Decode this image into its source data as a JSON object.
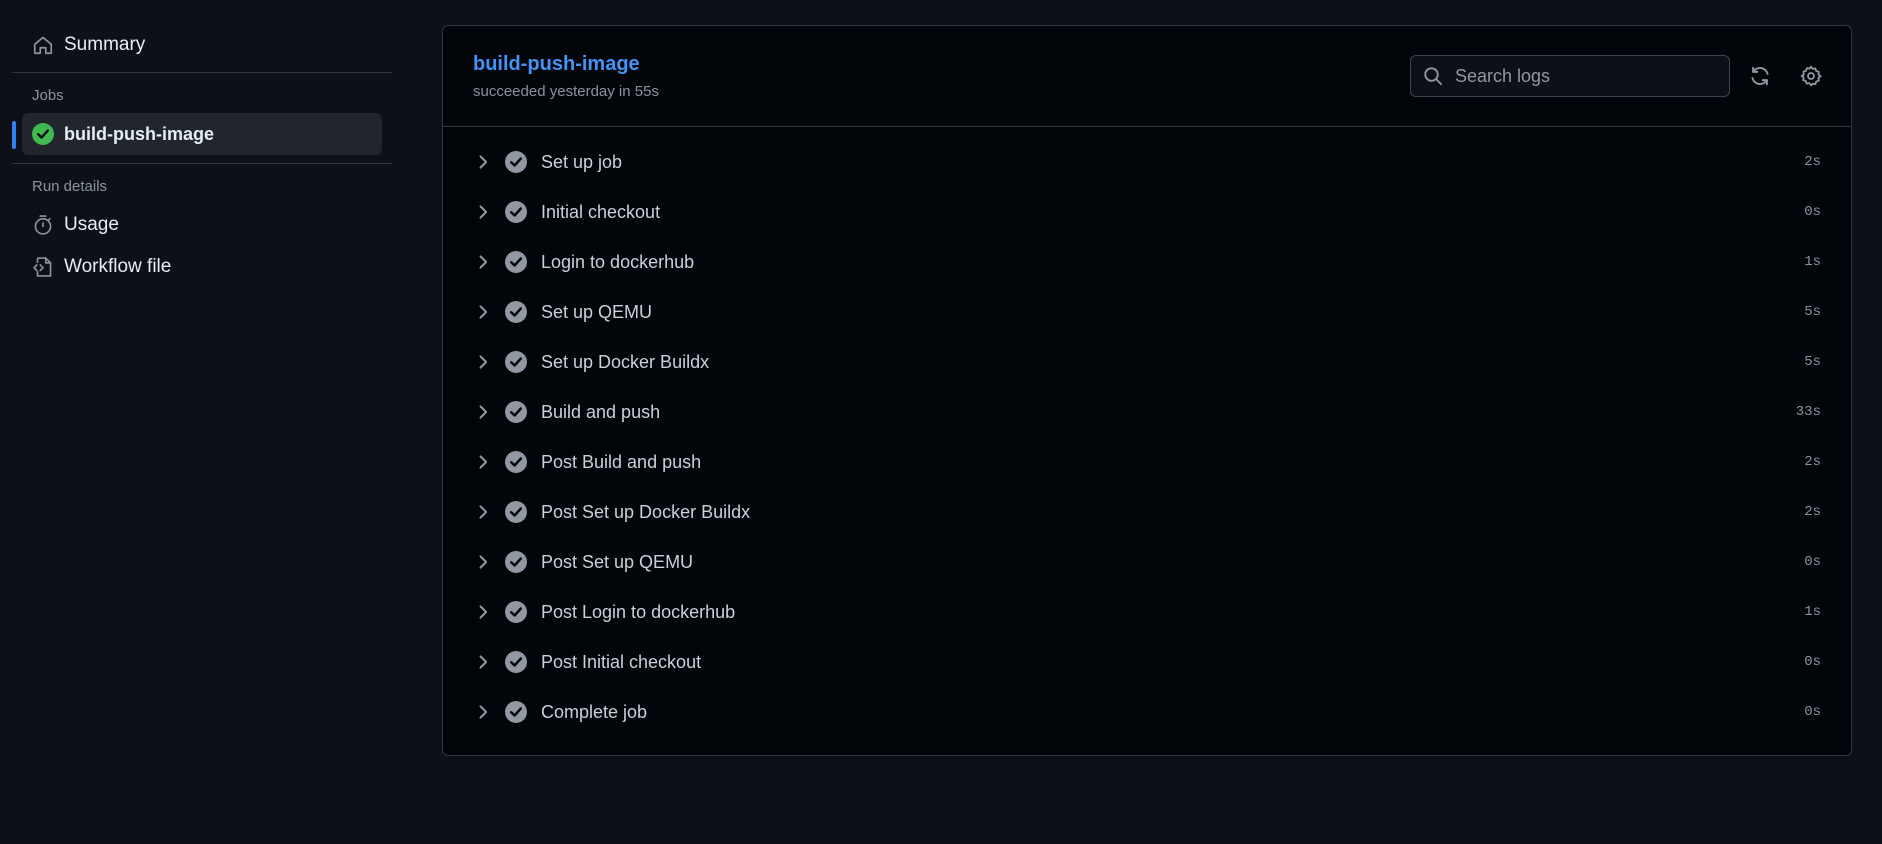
{
  "sidebar": {
    "summary_label": "Summary",
    "jobs_heading": "Jobs",
    "active_job": "build-push-image",
    "run_details_heading": "Run details",
    "usage_label": "Usage",
    "workflow_file_label": "Workflow file"
  },
  "job": {
    "title": "build-push-image",
    "status": "succeeded yesterday in 55s"
  },
  "search": {
    "placeholder": "Search logs"
  },
  "steps": [
    {
      "name": "Set up job",
      "duration": "2s"
    },
    {
      "name": "Initial checkout",
      "duration": "0s"
    },
    {
      "name": "Login to dockerhub",
      "duration": "1s"
    },
    {
      "name": "Set up QEMU",
      "duration": "5s"
    },
    {
      "name": "Set up Docker Buildx",
      "duration": "5s"
    },
    {
      "name": "Build and push",
      "duration": "33s"
    },
    {
      "name": "Post Build and push",
      "duration": "2s"
    },
    {
      "name": "Post Set up Docker Buildx",
      "duration": "2s"
    },
    {
      "name": "Post Set up QEMU",
      "duration": "0s"
    },
    {
      "name": "Post Login to dockerhub",
      "duration": "1s"
    },
    {
      "name": "Post Initial checkout",
      "duration": "0s"
    },
    {
      "name": "Complete job",
      "duration": "0s"
    }
  ],
  "icons": {
    "summary": "home-icon",
    "job_status": "check-circle-icon",
    "usage": "stopwatch-icon",
    "workflow_file": "file-code-icon",
    "search": "search-icon",
    "refresh": "refresh-icon",
    "settings": "gear-icon",
    "expand": "chevron-right-icon",
    "step_status": "check-circle-icon"
  },
  "colors": {
    "background": "#0d1117",
    "panel": "#010409",
    "accent": "#2f81f7",
    "link": "#4493f8",
    "success": "#3fb950",
    "muted": "#8b949e"
  }
}
